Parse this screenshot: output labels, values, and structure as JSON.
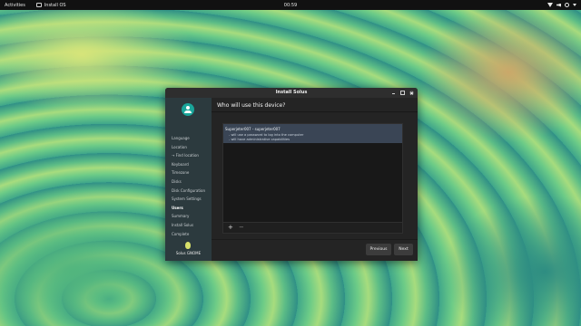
{
  "topbar": {
    "activities": "Activities",
    "app_name": "Install OS",
    "clock": "00:59",
    "icons": [
      "network-icon",
      "volume-icon",
      "power-icon",
      "menu-caret-icon"
    ]
  },
  "window": {
    "title": "Install Solus",
    "controls": [
      "minimize-icon",
      "maximize-icon",
      "close-icon"
    ]
  },
  "sidebar": {
    "steps": [
      {
        "label": "Language"
      },
      {
        "label": "Location"
      },
      {
        "label": "→ Find location"
      },
      {
        "label": "Keyboard"
      },
      {
        "label": "Timezone"
      },
      {
        "label": "Disks"
      },
      {
        "label": "Disk Configuration"
      },
      {
        "label": "System Settings"
      },
      {
        "label": "Users"
      },
      {
        "label": "Summary"
      },
      {
        "label": "Install Solus"
      },
      {
        "label": "Complete"
      }
    ],
    "active_step": "Users",
    "brand": "Solus GNOME"
  },
  "main": {
    "title": "Who will use this device?",
    "users": [
      {
        "heading": "Superjeter007 - superjeter007",
        "details": [
          "- will use a password to log into the computer",
          "- will have administrative capabilities"
        ]
      }
    ],
    "toolbar": {
      "add": "+",
      "remove": "−"
    }
  },
  "buttons": {
    "previous": "Previous",
    "next": "Next"
  },
  "colors": {
    "accent": "#1aa59a",
    "sidebar_bg": "#2c3a3e",
    "selected_row": "#3a4555",
    "window_bg": "#242424"
  }
}
